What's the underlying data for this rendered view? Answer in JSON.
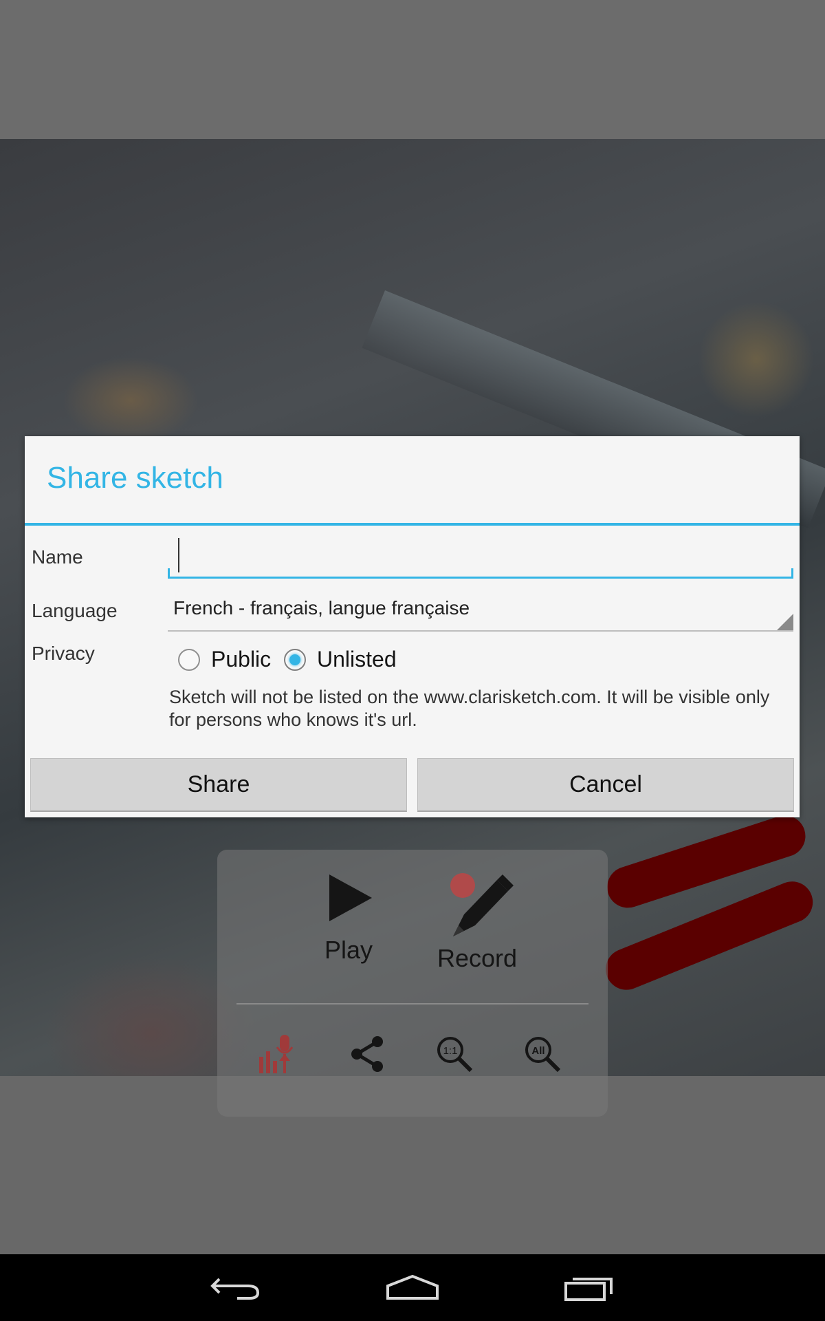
{
  "dialog": {
    "title": "Share sketch",
    "name_label": "Name",
    "name_value": "",
    "language_label": "Language",
    "language_value": "French - français, langue française",
    "privacy_label": "Privacy",
    "privacy_options": [
      {
        "label": "Public",
        "selected": false
      },
      {
        "label": "Unlisted",
        "selected": true
      }
    ],
    "privacy_info": "Sketch will not be listed on the www.clarisketch.com. It will be visible only for persons who knows it's url.",
    "share_label": "Share",
    "cancel_label": "Cancel",
    "accent_color": "#33b5e5"
  },
  "panel": {
    "play_label": "Play",
    "record_label": "Record",
    "tools": [
      "audio-levels-icon",
      "share-icon",
      "zoom-1-1-icon",
      "zoom-all-icon"
    ],
    "zoom_1_1_text": "1:1",
    "zoom_all_text": "All"
  },
  "navbar": {
    "icons": [
      "back-icon",
      "home-icon",
      "recents-icon"
    ]
  }
}
